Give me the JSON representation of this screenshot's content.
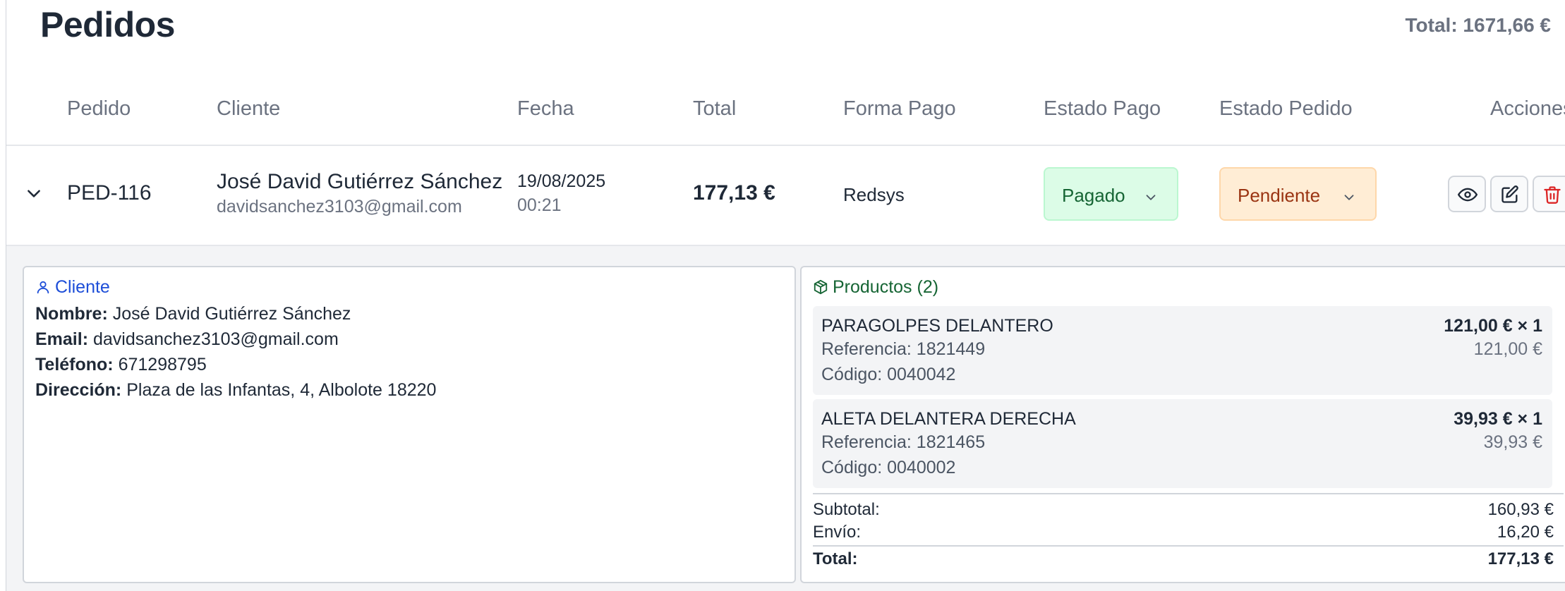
{
  "header": {
    "title": "Pedidos",
    "total_text": "Total: 1671,66 €"
  },
  "table": {
    "columns": [
      "Pedido",
      "Cliente",
      "Fecha",
      "Total",
      "Forma Pago",
      "Estado Pago",
      "Estado Pedido",
      "Acciones"
    ]
  },
  "order": {
    "id": "PED-116",
    "client_name": "José David Gutiérrez Sánchez",
    "client_email": "davidsanchez3103@gmail.com",
    "date": "19/08/2025",
    "time": "00:21",
    "total": "177,13 €",
    "payment_method": "Redsys",
    "payment_status": "Pagado",
    "order_status": "Pendiente",
    "expanded_icon": "chevron-down-icon",
    "actions": [
      {
        "name": "view",
        "icon": "eye-icon"
      },
      {
        "name": "edit",
        "icon": "edit-icon"
      },
      {
        "name": "delete",
        "icon": "trash-icon"
      }
    ]
  },
  "client_panel": {
    "title": "Cliente",
    "icon": "user-icon",
    "fields": [
      {
        "label": "Nombre:",
        "value": "José David Gutiérrez Sánchez"
      },
      {
        "label": "Email:",
        "value": "davidsanchez3103@gmail.com"
      },
      {
        "label": "Teléfono:",
        "value": "671298795"
      },
      {
        "label": "Dirección:",
        "value": "Plaza de las Infantas, 4, Albolote 18220"
      }
    ]
  },
  "products_panel": {
    "title": "Productos (2)",
    "icon": "package-icon",
    "items": [
      {
        "name": "PARAGOLPES DELANTERO",
        "reference": "Referencia: 1821449",
        "code": "Código: 0040042",
        "price_qty": "121,00 € × 1",
        "unit_total": "121,00 €"
      },
      {
        "name": "ALETA DELANTERA DERECHA",
        "reference": "Referencia: 1821465",
        "code": "Código: 0040002",
        "price_qty": "39,93 € × 1",
        "unit_total": "39,93 €"
      }
    ],
    "subtotal_label": "Subtotal:",
    "subtotal_value": "160,93 €",
    "shipping_label": "Envío:",
    "shipping_value": "16,20 €",
    "total_label": "Total:",
    "total_value": "177,13 €"
  },
  "colors": {
    "paid_bg": "#dcfce7",
    "paid_text": "#166534",
    "pending_bg": "#ffedd5",
    "pending_text": "#9a3412",
    "delete_red": "#dc2626",
    "client_accent": "#1d4ed8",
    "products_accent": "#166534"
  }
}
